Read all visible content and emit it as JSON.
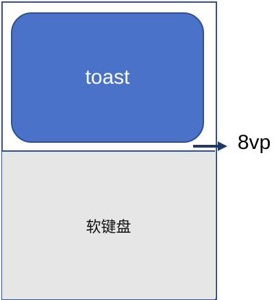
{
  "toast": {
    "label": "toast",
    "color": "#4a72c9"
  },
  "keyboard": {
    "label": "软键盘",
    "color": "#e6e6e6"
  },
  "gap": {
    "label": "8vp"
  },
  "colors": {
    "border": "#2f4f8f",
    "arrow": "#1f3864"
  }
}
